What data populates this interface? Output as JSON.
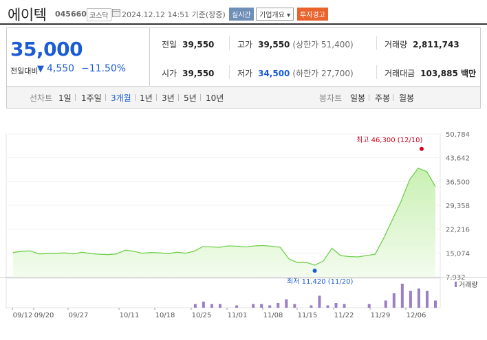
{
  "header": {
    "company": "에이텍",
    "code": "045660",
    "market": "코스닥",
    "datetime": "2024.12.12 14:51  기준(장중)",
    "btn_realtime": "실시간",
    "btn_company": "기업개요 ▾",
    "btn_warning": "투자경고"
  },
  "price": {
    "current": "35,000",
    "change_label": "전일대비",
    "change_arrow": "▼",
    "change": "4,550",
    "change_pct": "−11.50%",
    "colors": {
      "down": "#1b5bd4",
      "up": "#d0021b"
    }
  },
  "stats": {
    "prev_close_label": "전일",
    "prev_close": "39,550",
    "open_label": "시가",
    "open": "39,550",
    "high_label": "고가",
    "high": "39,550",
    "high_limit": "(상한가 51,400)",
    "low_label": "저가",
    "low": "34,500",
    "low_limit": "(하한가 27,700)",
    "volume_label": "거래량",
    "volume": "2,811,743",
    "amount_label": "거래대금",
    "amount": "103,885 백만"
  },
  "tabs": {
    "line_label": "선차트",
    "periods": [
      "1일",
      "1주일",
      "3개월",
      "1년",
      "3년",
      "5년",
      "10년"
    ],
    "active": "3개월",
    "candle_label": "봉차트",
    "candles": [
      "일봉",
      "주봉",
      "월봉"
    ]
  },
  "chart_data": {
    "type": "area",
    "y_ticks": [
      "50,784",
      "43,642",
      "36,500",
      "29,358",
      "22,216",
      "15,074",
      "7,932"
    ],
    "ylim": [
      7932,
      50784
    ],
    "x_labels": [
      "09/12",
      "09/20",
      "09/27",
      "10/11",
      "10/18",
      "10/25",
      "11/01",
      "11/08",
      "11/15",
      "11/22",
      "11/29",
      "12/06"
    ],
    "values": [
      15200,
      15600,
      15700,
      14800,
      14900,
      15000,
      15100,
      14800,
      15300,
      14900,
      14700,
      14600,
      14800,
      15900,
      15600,
      15000,
      15200,
      15100,
      14900,
      15300,
      15000,
      15600,
      17000,
      16900,
      16800,
      17200,
      17100,
      16900,
      17200,
      17300,
      17100,
      16800,
      13300,
      12200,
      12300,
      11420,
      12700,
      16500,
      14300,
      14000,
      13900,
      14300,
      14700,
      19500,
      25000,
      30500,
      37000,
      40500,
      39500,
      35000
    ],
    "volume_label": "거래량",
    "volumes": [
      0,
      0,
      0,
      0,
      0,
      0,
      0,
      0,
      0,
      0,
      0,
      0,
      0,
      0,
      0,
      0,
      0,
      0,
      0,
      0,
      0,
      0,
      3,
      5,
      3,
      3,
      0,
      2,
      0,
      3,
      3,
      2,
      4,
      7,
      3,
      0,
      2,
      10,
      2,
      4,
      3,
      0,
      0,
      3,
      0,
      6,
      12,
      20,
      14,
      16,
      14,
      6
    ],
    "annotations": {
      "high": "최고 46,300 (12/10)",
      "high_value": 46300,
      "low": "최저 11,420 (11/20)",
      "low_value": 11420
    },
    "colors": {
      "line": "#6fcf4a",
      "fill_top": "#c9f0b3",
      "fill_bottom": "#f3fcee",
      "volume": "#9b7fc4",
      "high": "#d0021b",
      "low": "#1b5bd4"
    }
  }
}
